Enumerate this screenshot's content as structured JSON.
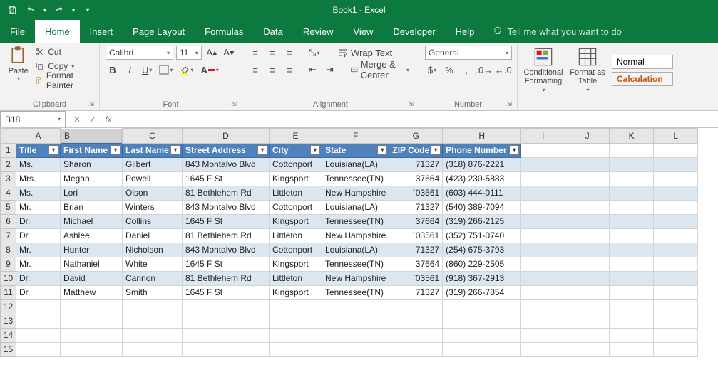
{
  "app": {
    "title": "Book1 - Excel"
  },
  "tabs": [
    "File",
    "Home",
    "Insert",
    "Page Layout",
    "Formulas",
    "Data",
    "Review",
    "View",
    "Developer",
    "Help"
  ],
  "tellme": "Tell me what you want to do",
  "ribbon": {
    "clipboard": {
      "cut": "Cut",
      "copy": "Copy",
      "fmt": "Format Painter",
      "paste": "Paste",
      "label": "Clipboard"
    },
    "font": {
      "name": "Calibri",
      "size": "11",
      "label": "Font"
    },
    "alignment": {
      "wrap": "Wrap Text",
      "merge": "Merge & Center",
      "label": "Alignment"
    },
    "number": {
      "format": "General",
      "label": "Number"
    },
    "styles": {
      "cond": "Conditional Formatting",
      "fmtTable": "Format as Table",
      "normal": "Normal",
      "calc": "Calculation"
    }
  },
  "namebox": "B18",
  "columns": [
    "A",
    "B",
    "C",
    "D",
    "E",
    "F",
    "G",
    "H",
    "I",
    "J",
    "K",
    "L"
  ],
  "headers": [
    "Title",
    "First Name",
    "Last Name",
    "Street Address",
    "City",
    "State",
    "ZIP Code",
    "Phone Number"
  ],
  "rows": [
    {
      "n": 2,
      "band": true,
      "c": [
        "Ms.",
        "Sharon",
        "Gilbert",
        "843 Montalvo Blvd",
        "Cottonport",
        "Louisiana(LA)",
        "71327",
        "(318) 876-2221"
      ]
    },
    {
      "n": 3,
      "band": false,
      "c": [
        "Mrs.",
        "Megan",
        "Powell",
        "1645 F St",
        "Kingsport",
        "Tennessee(TN)",
        "37664",
        "(423) 230-5883"
      ]
    },
    {
      "n": 4,
      "band": true,
      "c": [
        "Ms.",
        "Lori",
        "Olson",
        "81 Bethlehem Rd",
        "Littleton",
        "New Hampshire",
        "`03561",
        "(603) 444-0111"
      ]
    },
    {
      "n": 5,
      "band": false,
      "c": [
        "Mr.",
        "Brian",
        "Winters",
        "843 Montalvo Blvd",
        "Cottonport",
        "Louisiana(LA)",
        "71327",
        "(540) 389-7094"
      ]
    },
    {
      "n": 6,
      "band": true,
      "c": [
        "Dr.",
        "Michael",
        "Collins",
        "1645 F St",
        "Kingsport",
        "Tennessee(TN)",
        "37664",
        "(319) 266-2125"
      ]
    },
    {
      "n": 7,
      "band": false,
      "c": [
        "Dr.",
        "Ashlee",
        "Daniel",
        "81 Bethlehem Rd",
        "Littleton",
        "New Hampshire",
        "`03561",
        "(352) 751-0740"
      ]
    },
    {
      "n": 8,
      "band": true,
      "c": [
        "Mr.",
        "Hunter",
        "Nicholson",
        "843 Montalvo Blvd",
        "Cottonport",
        "Louisiana(LA)",
        "71327",
        "(254) 675-3793"
      ]
    },
    {
      "n": 9,
      "band": false,
      "c": [
        "Mr.",
        "Nathaniel",
        "White",
        "1645 F St",
        "Kingsport",
        "Tennessee(TN)",
        "37664",
        "(860) 229-2505"
      ]
    },
    {
      "n": 10,
      "band": true,
      "c": [
        "Dr.",
        "David",
        "Cannon",
        "81 Bethlehem Rd",
        "Littleton",
        "New Hampshire",
        "`03561",
        "(918) 367-2913"
      ]
    },
    {
      "n": 11,
      "band": false,
      "c": [
        "Dr.",
        "Matthew",
        "Smith",
        "1645 F St",
        "Kingsport",
        "Tennessee(TN)",
        "71327",
        "(319) 266-7854"
      ]
    }
  ],
  "emptyRows": [
    12,
    13,
    14,
    15
  ],
  "active": {
    "col": "B",
    "row": 18
  }
}
